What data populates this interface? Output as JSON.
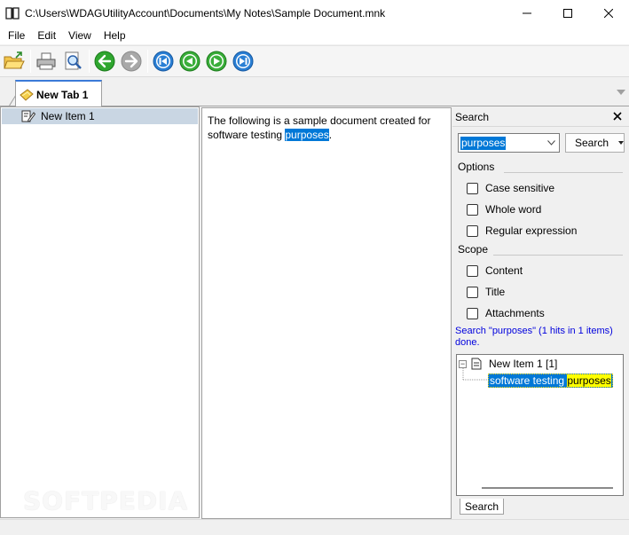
{
  "window": {
    "title": "C:\\Users\\WDAGUtilityAccount\\Documents\\My Notes\\Sample Document.mnk"
  },
  "menu": [
    {
      "label": "File"
    },
    {
      "label": "Edit"
    },
    {
      "label": "View"
    },
    {
      "label": "Help"
    }
  ],
  "toolbar": {
    "buttons": [
      "open-folder-icon",
      "print-icon",
      "print-preview-icon",
      "back-icon",
      "forward-icon",
      "first-icon",
      "previous-icon",
      "next-icon",
      "last-icon"
    ]
  },
  "tabs": [
    {
      "label": "New Tab 1"
    }
  ],
  "tree": {
    "items": [
      {
        "label": "New Item 1"
      }
    ]
  },
  "editor": {
    "text_before": "The following is a sample document created for software testing ",
    "highlighted": "purposes",
    "text_after": "."
  },
  "search_panel": {
    "title": "Search",
    "query": "purposes",
    "search_button": "Search",
    "options_label": "Options",
    "options": [
      {
        "label": "Case sensitive",
        "checked": false
      },
      {
        "label": "Whole word",
        "checked": false
      },
      {
        "label": "Regular expression",
        "checked": false
      }
    ],
    "scope_label": "Scope",
    "scope": [
      {
        "label": "Content",
        "checked": false
      },
      {
        "label": "Title",
        "checked": false
      },
      {
        "label": "Attachments",
        "checked": false
      }
    ],
    "status": "Search \"purposes\" (1 hits in 1 items) done.",
    "results": {
      "item_label": "New Item 1 [1]",
      "hit_prefix": "software testing ",
      "hit_match": "purposes"
    },
    "bottom_tab": "Search"
  },
  "colors": {
    "selection": "#0078d7",
    "match_highlight": "#ffff00",
    "status_text": "#0000dd",
    "tree_selection": "#c9d6e3"
  },
  "watermark": "SOFTPEDIA"
}
